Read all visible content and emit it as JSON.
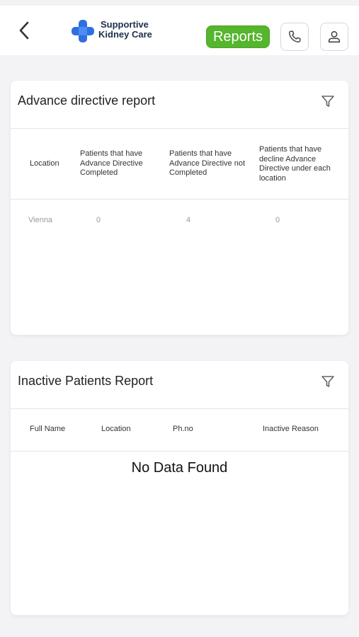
{
  "header": {
    "logo_line1": "Supportive",
    "logo_line2": "Kidney Care",
    "reports_label": "Reports"
  },
  "advance_directive": {
    "title": "Advance directive report",
    "columns": [
      "Location",
      "Patients that have Advance Directive Completed",
      "Patients that have Advance Directive not Completed",
      "Patients that have decline Advance Directive under each location"
    ],
    "rows": [
      [
        "Vienna",
        "0",
        "4",
        "0"
      ]
    ]
  },
  "inactive_patients": {
    "title": "Inactive Patients Report",
    "columns": [
      "Full Name",
      "Location",
      "Ph.no",
      "Inactive Reason"
    ],
    "empty_message": "No Data Found"
  },
  "colors": {
    "accent_green": "#55b52c",
    "logo_blue": "#2f6fe0",
    "background": "#f3f3f5"
  },
  "icons": [
    "back-chevron-icon",
    "logo-cross-icon",
    "phone-icon",
    "user-icon",
    "filter-icon"
  ]
}
